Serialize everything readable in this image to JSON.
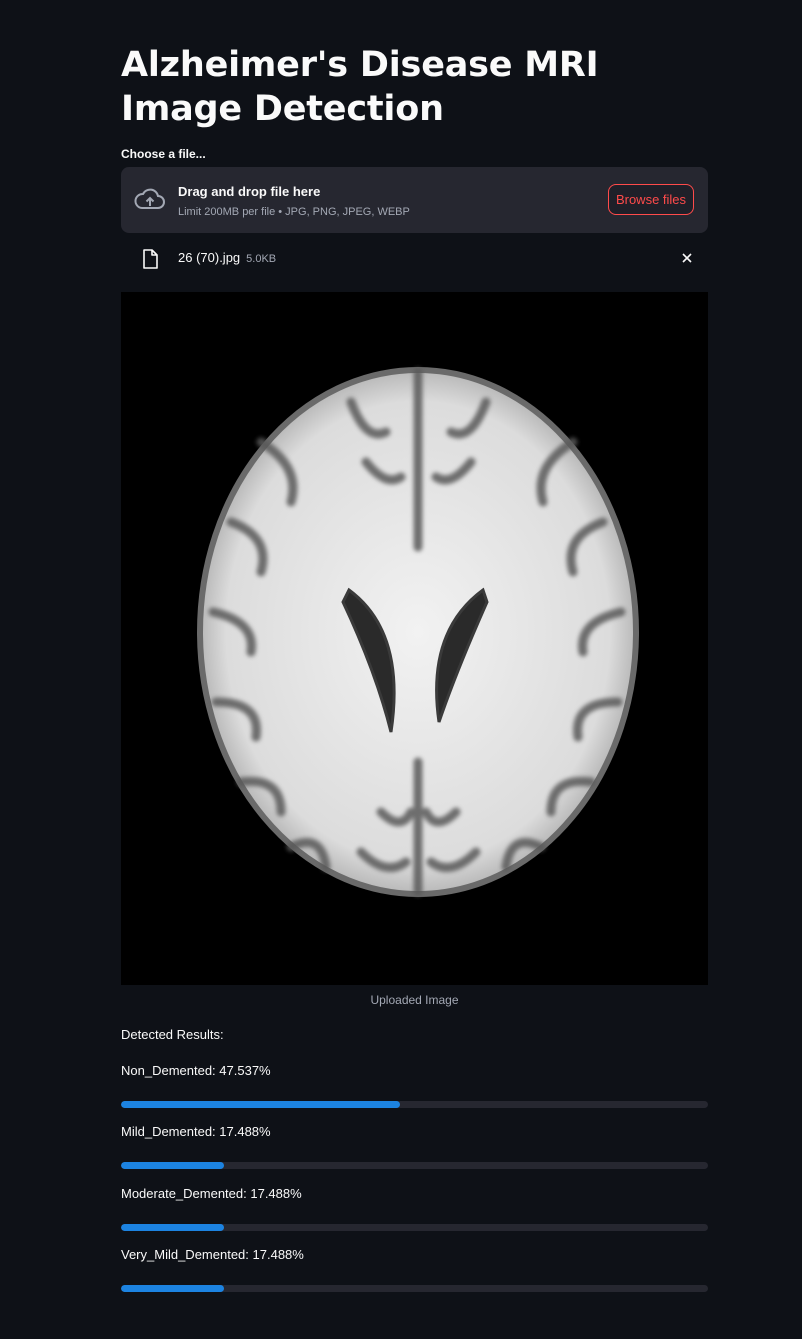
{
  "page": {
    "title": "Alzheimer's Disease MRI Image Detection"
  },
  "uploader": {
    "label": "Choose a file...",
    "drop_title": "Drag and drop file here",
    "limit_text": "Limit 200MB per file • JPG, PNG, JPEG, WEBP",
    "browse_label": "Browse files"
  },
  "file": {
    "name": "26 (70).jpg",
    "size": "5.0KB"
  },
  "image": {
    "caption": "Uploaded Image"
  },
  "results": {
    "heading": "Detected Results:",
    "items": [
      {
        "label": "Non_Demented: 47.537%",
        "value": 0.47537
      },
      {
        "label": "Mild_Demented: 17.488%",
        "value": 0.17488
      },
      {
        "label": "Moderate_Demented: 17.488%",
        "value": 0.17488
      },
      {
        "label": "Very_Mild_Demented: 17.488%",
        "value": 0.17488
      }
    ]
  },
  "colors": {
    "background": "#0e1117",
    "accent": "#ff4b4b",
    "progress": "#1c83e1",
    "panel": "#262730"
  }
}
